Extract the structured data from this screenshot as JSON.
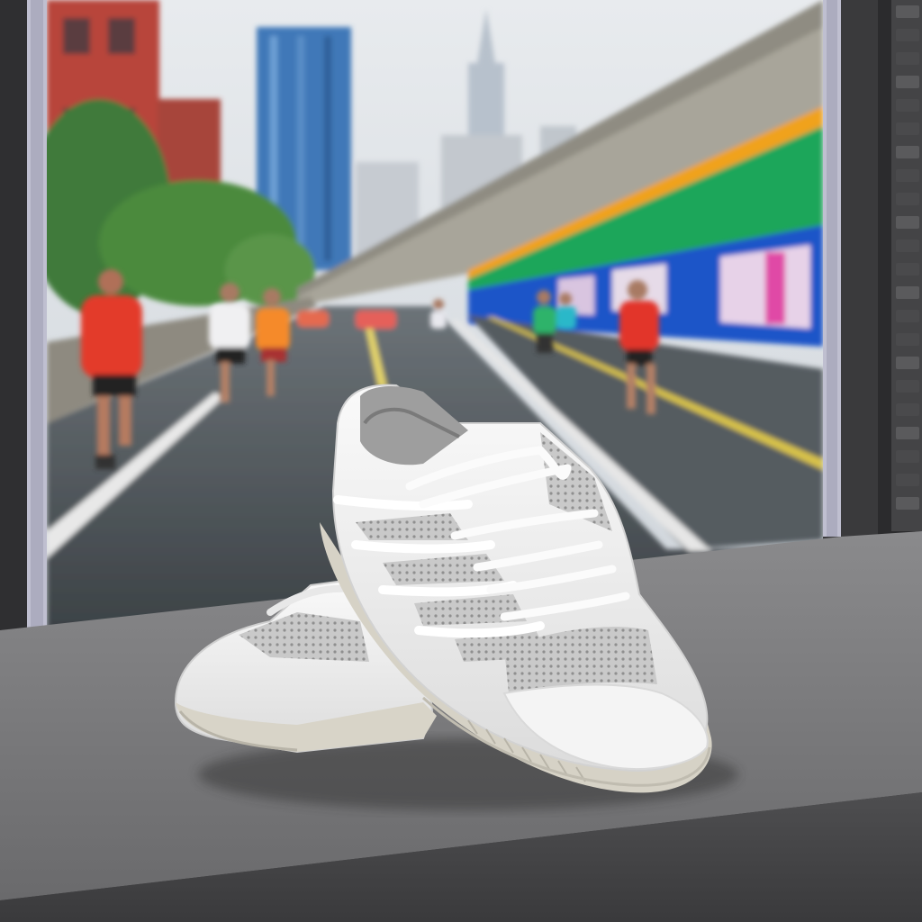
{
  "image": {
    "description_free": true
  },
  "colors": {
    "sky": "#dfe3e8",
    "brick": "#b8453a",
    "glass_tower": "#3f78b8",
    "road": "#4b5157",
    "green_band": "#1aa65a",
    "orange_band": "#f0a21c",
    "blue_wall": "#1f55c8",
    "runner_red": "#e33a2c",
    "runner_orange": "#f58a2a",
    "counter": "#6e6e70",
    "monitor_bezel": "#3c3c3e",
    "side_panel": "#2b2b2d",
    "shoe_white": "#f2f2f2",
    "mesh_gray": "#bdbdbd"
  },
  "side_panel": {
    "rows": 22
  }
}
